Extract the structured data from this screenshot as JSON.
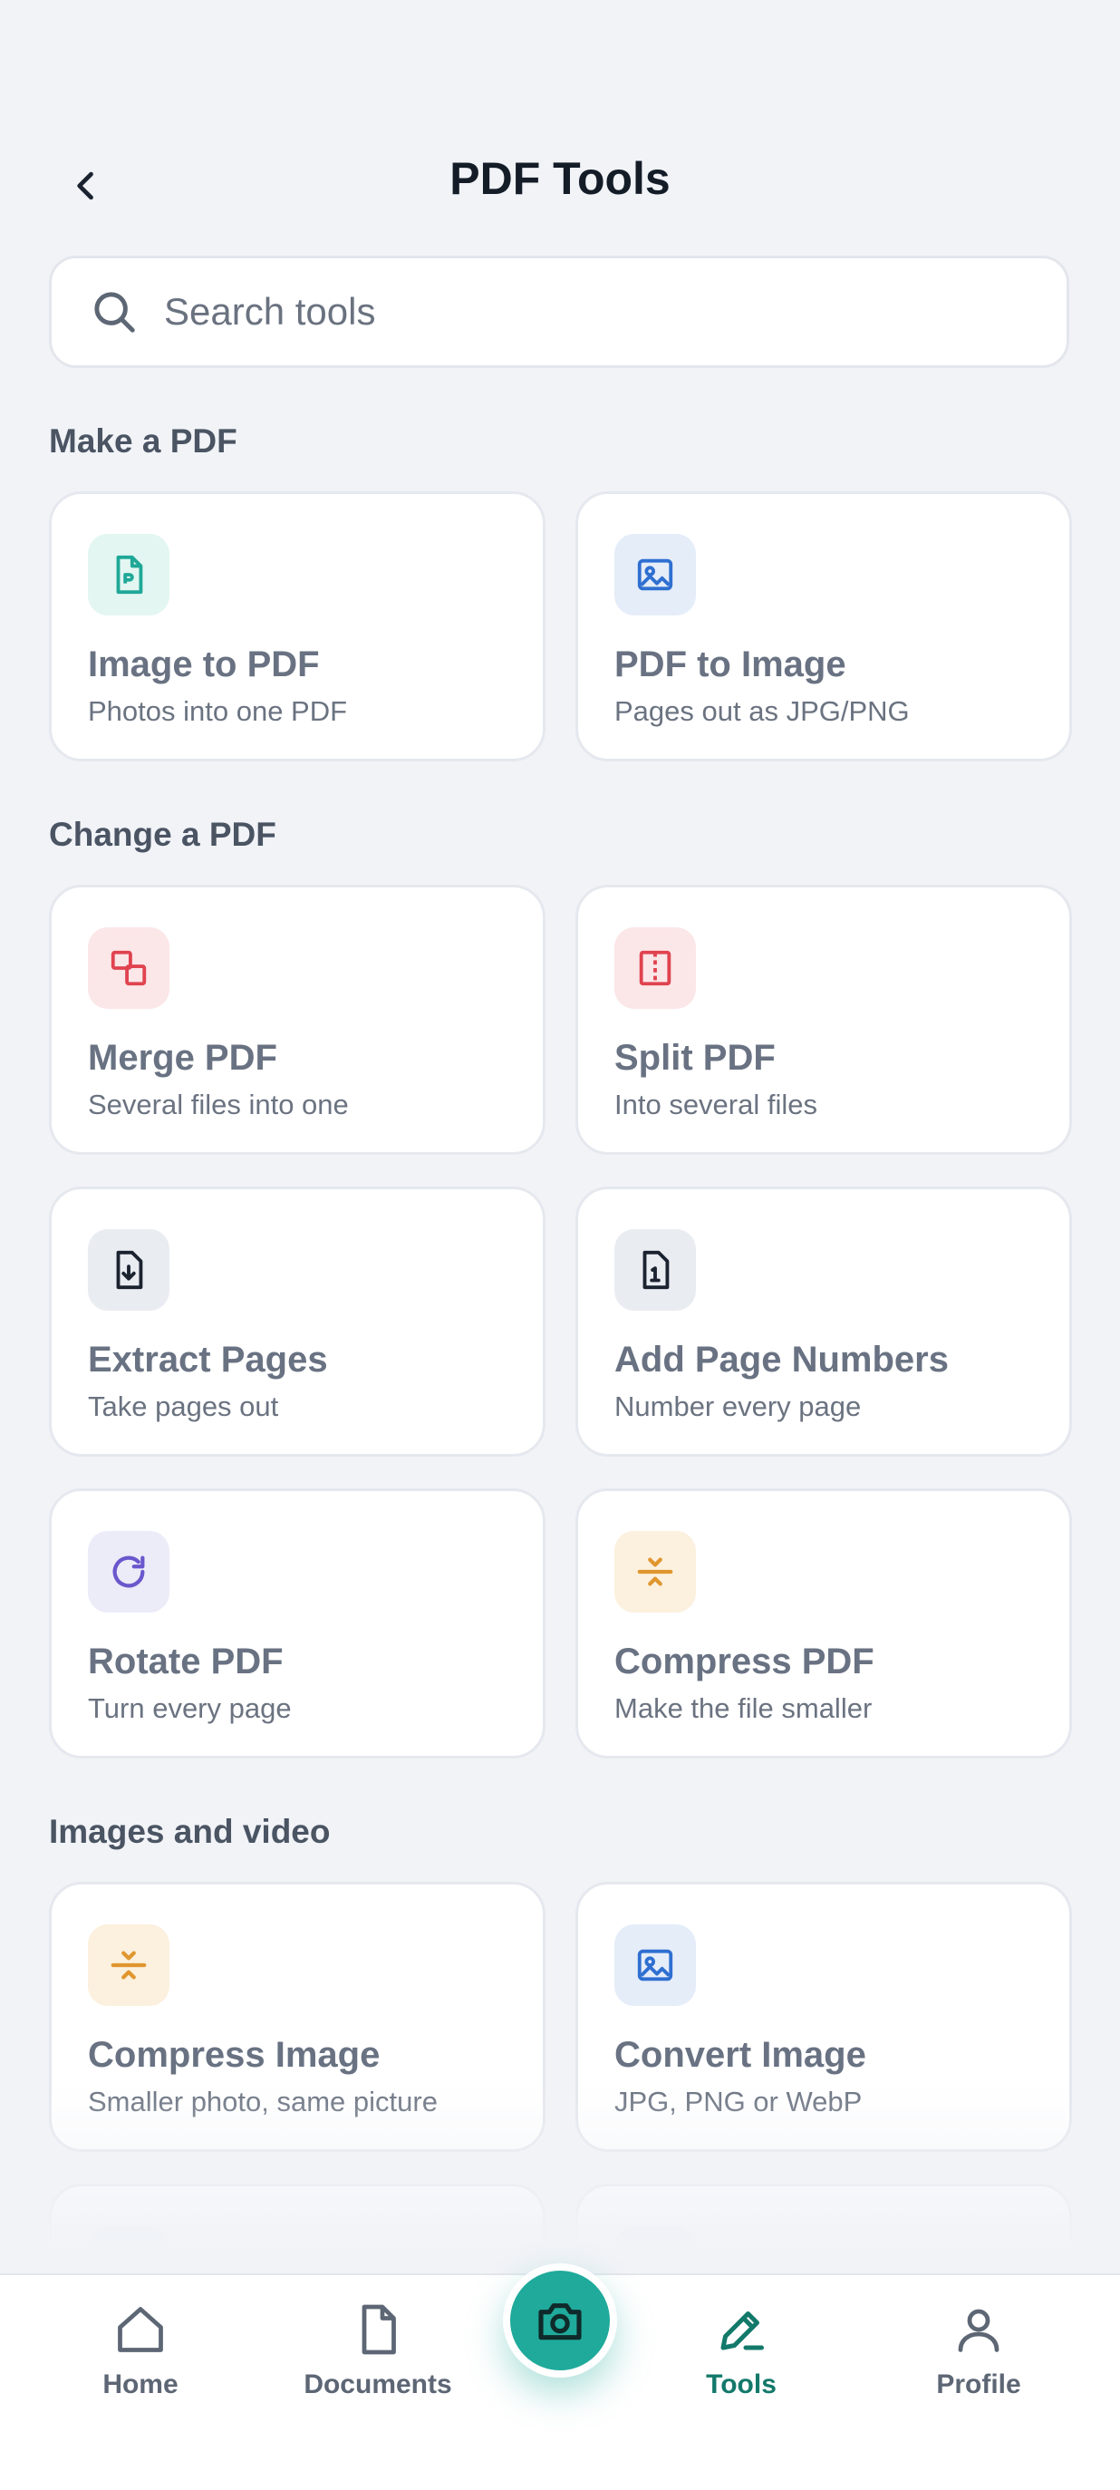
{
  "header": {
    "title": "PDF Tools",
    "back_icon": "chevron-left-icon"
  },
  "search": {
    "placeholder": "Search tools",
    "icon": "search-icon"
  },
  "sections": [
    {
      "title": "Make a PDF"
    },
    {
      "title": "Change a PDF"
    },
    {
      "title": "Images and video"
    }
  ],
  "tools": [
    {
      "title": "Image to PDF",
      "subtitle": "Photos into one PDF",
      "icon": "pdf-file-icon",
      "tint": "#e3f6f2",
      "color": "#1fa897"
    },
    {
      "title": "PDF to Image",
      "subtitle": "Pages out as JPG/PNG",
      "icon": "image-icon",
      "tint": "#e5edf9",
      "color": "#2f6fd1"
    },
    {
      "title": "Merge PDF",
      "subtitle": "Several files into one",
      "icon": "merge-icon",
      "tint": "#fbe6e8",
      "color": "#e0434f"
    },
    {
      "title": "Split PDF",
      "subtitle": "Into several files",
      "icon": "split-icon",
      "tint": "#fbe6e8",
      "color": "#e0434f"
    },
    {
      "title": "Extract Pages",
      "subtitle": "Take pages out",
      "icon": "file-download-icon",
      "tint": "#e9ecf1",
      "color": "#1b2330"
    },
    {
      "title": "Add Page Numbers",
      "subtitle": "Number every page",
      "icon": "file-number-icon",
      "tint": "#e9ecf1",
      "color": "#1b2330"
    },
    {
      "title": "Rotate PDF",
      "subtitle": "Turn every page",
      "icon": "rotate-icon",
      "tint": "#ecebf8",
      "color": "#6a57cc"
    },
    {
      "title": "Compress PDF",
      "subtitle": "Make the file smaller",
      "icon": "compress-icon",
      "tint": "#fcf0de",
      "color": "#e0962e"
    },
    {
      "title": "Compress Image",
      "subtitle": "Smaller photo, same picture",
      "icon": "compress-icon",
      "tint": "#fcf0de",
      "color": "#e0962e"
    },
    {
      "title": "Convert Image",
      "subtitle": "JPG, PNG or WebP",
      "icon": "image-icon",
      "tint": "#e5edf9",
      "color": "#2f6fd1"
    }
  ],
  "nav": {
    "items": [
      {
        "label": "Home",
        "icon": "home-icon"
      },
      {
        "label": "Documents",
        "icon": "document-icon"
      },
      {
        "label": "Tools",
        "icon": "pencil-icon",
        "active": true
      },
      {
        "label": "Profile",
        "icon": "user-icon"
      }
    ],
    "fab_icon": "camera-icon",
    "active_color": "#13796a",
    "accent": "#1faa9b"
  }
}
